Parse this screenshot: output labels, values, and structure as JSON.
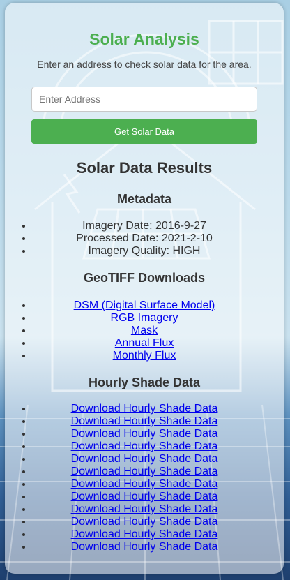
{
  "app": {
    "title": "Solar Analysis",
    "subtitle": "Enter an address to check solar data for the area."
  },
  "form": {
    "address_placeholder": "Enter Address",
    "address_value": "",
    "submit_label": "Get Solar Data"
  },
  "results": {
    "heading": "Solar Data Results",
    "metadata": {
      "heading": "Metadata",
      "items": [
        "Imagery Date: 2016-9-27",
        "Processed Date: 2021-2-10",
        "Imagery Quality: HIGH"
      ]
    },
    "geotiff": {
      "heading": "GeoTIFF Downloads",
      "links": [
        "DSM (Digital Surface Model)",
        "RGB Imagery",
        "Mask",
        "Annual Flux",
        "Monthly Flux"
      ]
    },
    "hourly_shade": {
      "heading": "Hourly Shade Data",
      "links": [
        "Download Hourly Shade Data",
        "Download Hourly Shade Data",
        "Download Hourly Shade Data",
        "Download Hourly Shade Data",
        "Download Hourly Shade Data",
        "Download Hourly Shade Data",
        "Download Hourly Shade Data",
        "Download Hourly Shade Data",
        "Download Hourly Shade Data",
        "Download Hourly Shade Data",
        "Download Hourly Shade Data",
        "Download Hourly Shade Data"
      ]
    }
  },
  "colors": {
    "accent": "#4caf50",
    "link": "#0000ee",
    "text": "#333333"
  }
}
